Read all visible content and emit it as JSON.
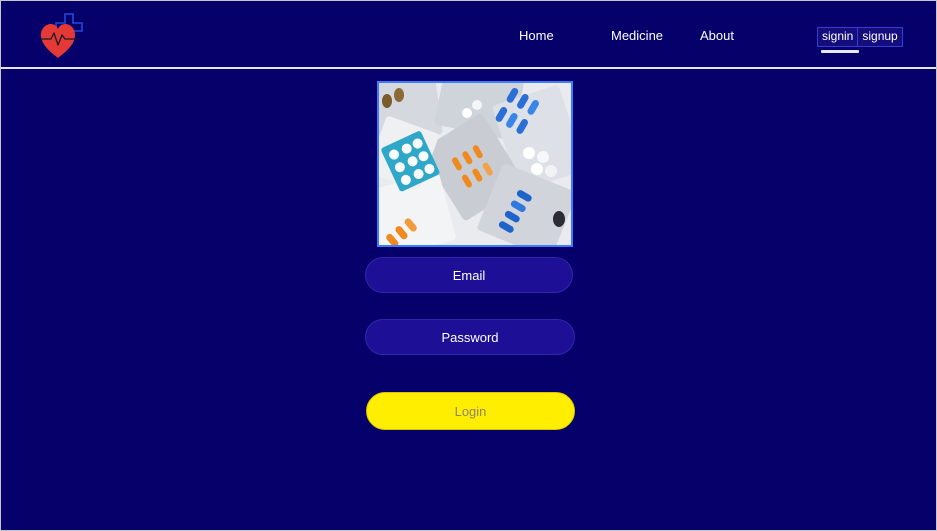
{
  "colors": {
    "background": "#06006a",
    "input_fill": "#1d0f96",
    "button_fill": "#ffee00",
    "button_text": "#8a8770",
    "hero_border": "#3d7bff",
    "logo_heart": "#e53935",
    "logo_cross": "#1e40c8"
  },
  "header": {
    "logo_icon": "heart-pulse-cross-logo",
    "nav": {
      "home": "Home",
      "medicine": "Medicine",
      "about": "About"
    },
    "auth": {
      "signin": "signin",
      "signup": "signup",
      "active": "signin"
    }
  },
  "hero": {
    "image_icon": "medicine-pills-photo"
  },
  "login_form": {
    "email_placeholder": "Email",
    "password_placeholder": "Password",
    "submit_label": "Login"
  }
}
